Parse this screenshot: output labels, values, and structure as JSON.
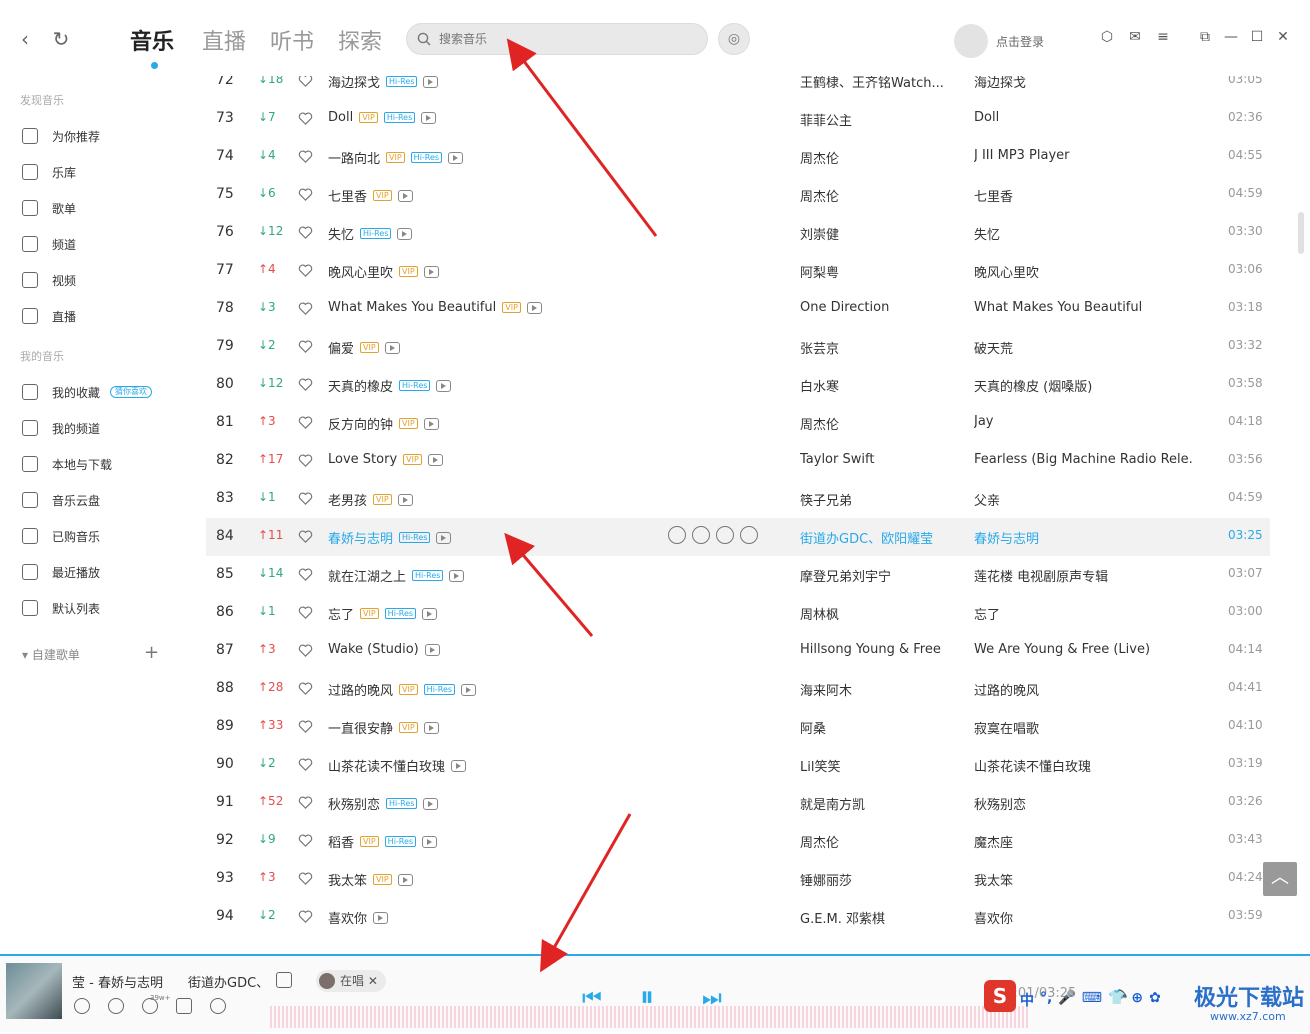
{
  "header": {
    "tabs": [
      "音乐",
      "直播",
      "听书",
      "探索"
    ],
    "search_placeholder": "搜索音乐",
    "login": "点击登录"
  },
  "sidebar": {
    "discover_title": "发现音乐",
    "discover": [
      "为你推荐",
      "乐库",
      "歌单",
      "频道",
      "视频",
      "直播"
    ],
    "mine_title": "我的音乐",
    "mine": [
      "我的收藏",
      "我的频道",
      "本地与下载",
      "音乐云盘",
      "已购音乐",
      "最近播放",
      "默认列表"
    ],
    "fav_badge": "猜你喜欢",
    "selfmade": "自建歌单"
  },
  "songs": [
    {
      "rank": "72",
      "chg": "↓18",
      "dir": "down",
      "title": "海边探戈",
      "tags": [
        "hr"
      ],
      "artist": "王鹤棣、王齐铭Watch...",
      "album": "海边探戈",
      "dur": "03:05"
    },
    {
      "rank": "73",
      "chg": "↓7",
      "dir": "down",
      "title": "Doll",
      "tags": [
        "vip",
        "hr"
      ],
      "artist": "菲菲公主",
      "album": "Doll",
      "dur": "02:36"
    },
    {
      "rank": "74",
      "chg": "↓4",
      "dir": "down",
      "title": "一路向北",
      "tags": [
        "vip",
        "hr"
      ],
      "artist": "周杰伦",
      "album": "J III MP3 Player",
      "dur": "04:55"
    },
    {
      "rank": "75",
      "chg": "↓6",
      "dir": "down",
      "title": "七里香",
      "tags": [
        "vip"
      ],
      "artist": "周杰伦",
      "album": "七里香",
      "dur": "04:59"
    },
    {
      "rank": "76",
      "chg": "↓12",
      "dir": "down",
      "title": "失忆",
      "tags": [
        "hr"
      ],
      "artist": "刘崇健",
      "album": "失忆",
      "dur": "03:30"
    },
    {
      "rank": "77",
      "chg": "↑4",
      "dir": "up",
      "title": "晚风心里吹",
      "tags": [
        "vip"
      ],
      "artist": "阿梨粤",
      "album": "晚风心里吹",
      "dur": "03:06"
    },
    {
      "rank": "78",
      "chg": "↓3",
      "dir": "down",
      "title": "What Makes You Beautiful",
      "tags": [
        "vip"
      ],
      "artist": "One Direction",
      "album": "What Makes You Beautiful",
      "dur": "03:18"
    },
    {
      "rank": "79",
      "chg": "↓2",
      "dir": "down",
      "title": "偏爱",
      "tags": [
        "vip"
      ],
      "artist": "张芸京",
      "album": "破天荒",
      "dur": "03:32"
    },
    {
      "rank": "80",
      "chg": "↓12",
      "dir": "down",
      "title": "天真的橡皮",
      "tags": [
        "hr"
      ],
      "artist": "白水寒",
      "album": "天真的橡皮 (烟嗓版)",
      "dur": "03:58"
    },
    {
      "rank": "81",
      "chg": "↑3",
      "dir": "up",
      "title": "反方向的钟",
      "tags": [
        "vip"
      ],
      "artist": "周杰伦",
      "album": "Jay",
      "dur": "04:18"
    },
    {
      "rank": "82",
      "chg": "↑17",
      "dir": "up",
      "title": "Love Story",
      "tags": [
        "vip"
      ],
      "artist": "Taylor Swift",
      "album": "Fearless (Big Machine Radio Rele...",
      "dur": "03:56"
    },
    {
      "rank": "83",
      "chg": "↓1",
      "dir": "down",
      "title": "老男孩",
      "tags": [
        "vip"
      ],
      "artist": "筷子兄弟",
      "album": "父亲",
      "dur": "04:59"
    },
    {
      "rank": "84",
      "chg": "↑11",
      "dir": "up",
      "title": "春娇与志明",
      "tags": [
        "hr"
      ],
      "artist": "街道办GDC、欧阳耀莹",
      "album": "春娇与志明",
      "dur": "03:25",
      "hl": true
    },
    {
      "rank": "85",
      "chg": "↓14",
      "dir": "down",
      "title": "就在江湖之上",
      "tags": [
        "hr"
      ],
      "artist": "摩登兄弟刘宇宁",
      "album": "莲花楼 电视剧原声专辑",
      "dur": "03:07"
    },
    {
      "rank": "86",
      "chg": "↓1",
      "dir": "down",
      "title": "忘了",
      "tags": [
        "vip",
        "hr"
      ],
      "artist": "周林枫",
      "album": "忘了",
      "dur": "03:00"
    },
    {
      "rank": "87",
      "chg": "↑3",
      "dir": "up",
      "title": "Wake (Studio)",
      "tags": [],
      "artist": "Hillsong Young & Free",
      "album": "We Are Young & Free (Live)",
      "dur": "04:14"
    },
    {
      "rank": "88",
      "chg": "↑28",
      "dir": "up",
      "title": "过路的晚风",
      "tags": [
        "vip",
        "hr"
      ],
      "artist": "海来阿木",
      "album": "过路的晚风",
      "dur": "04:41"
    },
    {
      "rank": "89",
      "chg": "↑33",
      "dir": "up",
      "title": "一直很安静",
      "tags": [
        "vip"
      ],
      "artist": "阿桑",
      "album": "寂寞在唱歌",
      "dur": "04:10"
    },
    {
      "rank": "90",
      "chg": "↓2",
      "dir": "down",
      "title": "山茶花读不懂白玫瑰",
      "tags": [],
      "artist": "Lil笑笑",
      "album": "山茶花读不懂白玫瑰",
      "dur": "03:19"
    },
    {
      "rank": "91",
      "chg": "↑52",
      "dir": "up",
      "title": "秋殇别恋",
      "tags": [
        "hr"
      ],
      "artist": "就是南方凯",
      "album": "秋殇别恋",
      "dur": "03:26"
    },
    {
      "rank": "92",
      "chg": "↓9",
      "dir": "down",
      "title": "稻香",
      "tags": [
        "vip",
        "hr"
      ],
      "artist": "周杰伦",
      "album": "魔杰座",
      "dur": "03:43"
    },
    {
      "rank": "93",
      "chg": "↑3",
      "dir": "up",
      "title": "我太笨",
      "tags": [
        "vip"
      ],
      "artist": "锤娜丽莎",
      "album": "我太笨",
      "dur": "04:24"
    },
    {
      "rank": "94",
      "chg": "↓2",
      "dir": "down",
      "title": "喜欢你",
      "tags": [],
      "artist": "G.E.M. 邓紫棋",
      "album": "喜欢你",
      "dur": "03:59"
    }
  ],
  "player": {
    "title": "莹 - 春娇与志明",
    "artist": "街道办GDC、",
    "live": "在唱",
    "count": "39w+",
    "time": "01:01/03:25"
  },
  "watermark": {
    "name": "极光下载站",
    "url": "www.xz7.com",
    "ime": [
      "中",
      "°,",
      "🎤",
      "⌨",
      "👕",
      "⊕",
      "✿"
    ]
  },
  "tag_labels": {
    "vip": "VIP",
    "hr": "Hi-Res"
  },
  "colors": {
    "accent": "#2aa9e8",
    "up": "#e64c4c",
    "down": "#31a77c",
    "arrow": "#e02424"
  }
}
